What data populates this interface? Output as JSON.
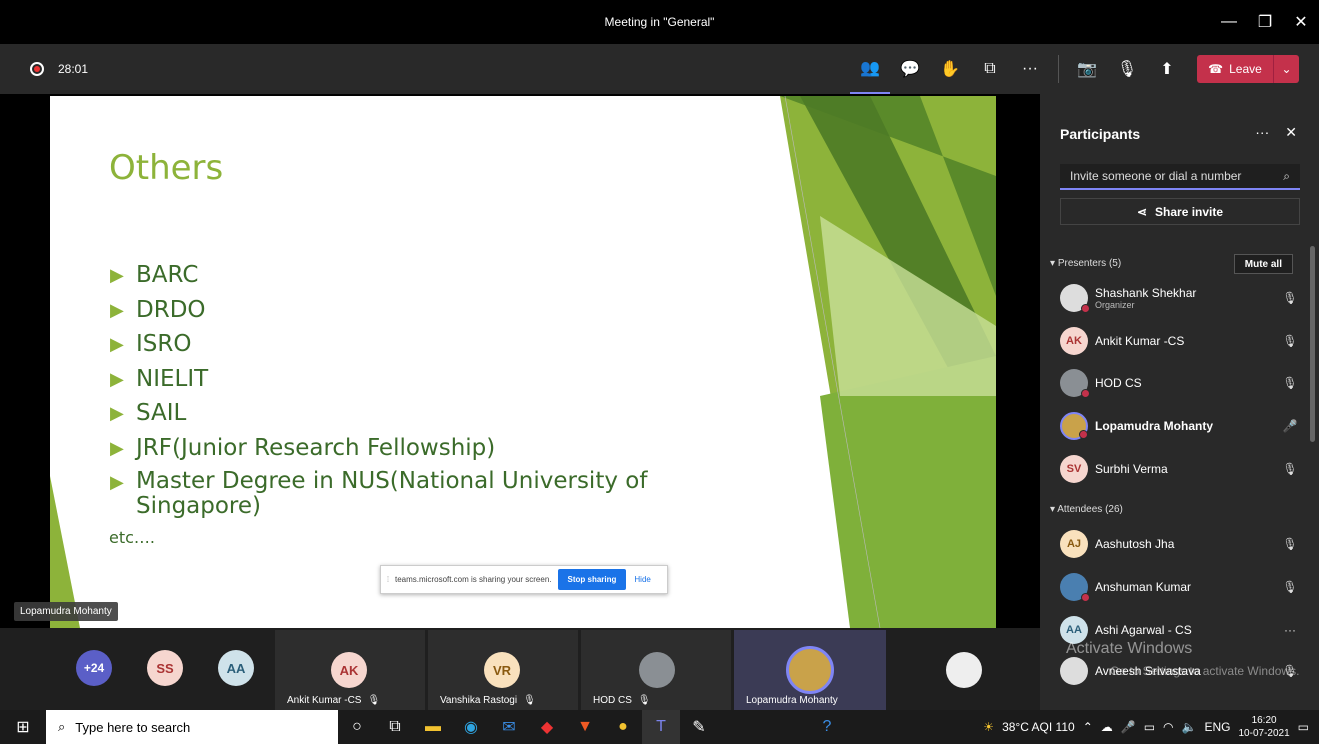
{
  "window": {
    "title": "Meeting in \"General\""
  },
  "toolbar": {
    "recording_time": "28:01",
    "leave_label": "Leave"
  },
  "slide": {
    "heading": "Others",
    "bullets": [
      "BARC",
      "DRDO",
      "ISRO",
      "NIELIT",
      "SAIL",
      "JRF(Junior Research Fellowship)",
      " Master Degree in NUS(National University of Singapore)"
    ],
    "footer_text": "etc….",
    "presenter_label": "Lopamudra Mohanty"
  },
  "share_bar": {
    "message": "teams.microsoft.com is sharing your screen.",
    "stop_label": "Stop sharing",
    "hide_label": "Hide"
  },
  "strip": {
    "overflow_count": "+24",
    "avatars": [
      "SS",
      "AA"
    ],
    "tiles": [
      {
        "initials": "AK",
        "name": "Ankit Kumar -CS"
      },
      {
        "initials": "VR",
        "name": "Vanshika Rastogi"
      },
      {
        "initials": "",
        "name": "HOD CS"
      },
      {
        "initials": "",
        "name": "Lopamudra Mohanty"
      }
    ]
  },
  "panel": {
    "title": "Participants",
    "invite_placeholder": "Invite someone or dial a number",
    "share_invite_label": "Share invite",
    "presenters_label": "Presenters (5)",
    "mute_all_label": "Mute all",
    "presenters": [
      {
        "initials": "",
        "name": "Shashank Shekhar",
        "role": "Organizer"
      },
      {
        "initials": "AK",
        "name": "Ankit Kumar -CS",
        "role": ""
      },
      {
        "initials": "",
        "name": "HOD CS",
        "role": ""
      },
      {
        "initials": "",
        "name": "Lopamudra Mohanty",
        "role": ""
      },
      {
        "initials": "SV",
        "name": "Surbhi Verma",
        "role": ""
      }
    ],
    "attendees_label": "Attendees (26)",
    "attendees": [
      {
        "initials": "AJ",
        "name": "Aashutosh Jha"
      },
      {
        "initials": "",
        "name": "Anshuman Kumar"
      },
      {
        "initials": "AA",
        "name": "Ashi Agarwal - CS"
      },
      {
        "initials": "",
        "name": "Avneesh Srivastava"
      }
    ],
    "watermark_title": "Activate Windows",
    "watermark_sub": "Go to Settings to activate Windows."
  },
  "taskbar": {
    "search_placeholder": "Type here to search",
    "weather": "38°C AQI 110",
    "language": "ENG",
    "time": "16:20",
    "date": "10-07-2021"
  }
}
